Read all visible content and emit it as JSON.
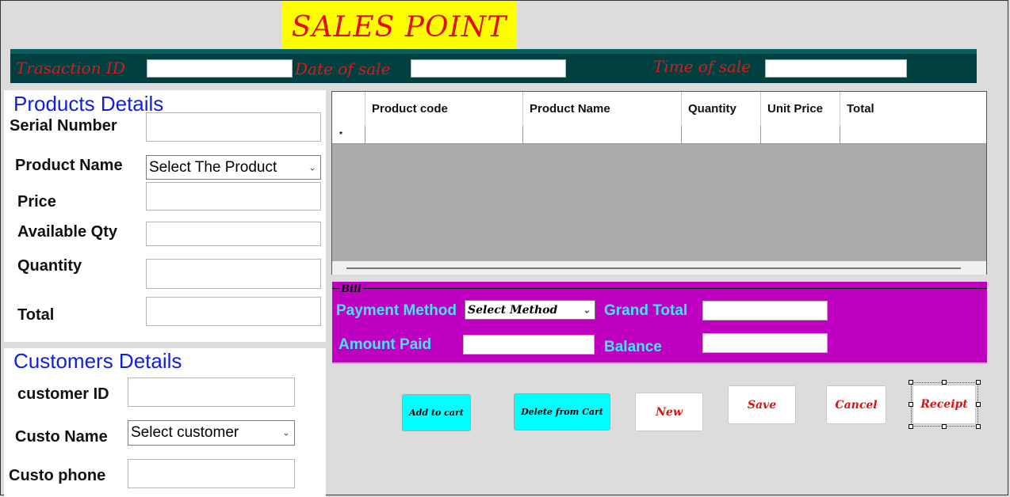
{
  "header": {
    "title": "SALES POINT"
  },
  "top_bar": {
    "transaction_label": "Trasaction ID",
    "date_label": "Date of sale",
    "time_label": "Time of sale"
  },
  "products": {
    "title": "Products Details",
    "serial_label": "Serial Number",
    "product_name_label": "Product Name",
    "product_select_value": "Select The Product",
    "price_label": "Price",
    "available_label": "Available Qty",
    "quantity_label": "Quantity",
    "total_label": "Total"
  },
  "customers": {
    "title": "Customers Details",
    "id_label": "customer ID",
    "name_label": "Custo Name",
    "name_select_value": "Select customer",
    "phone_label": "Custo phone"
  },
  "grid": {
    "columns": [
      "Product code",
      "Product Name",
      "Quantity",
      "Unit Price",
      "Total"
    ],
    "new_row_marker": "*"
  },
  "bill": {
    "legend": "Bill",
    "payment_label": "Payment Method",
    "payment_select_value": "Select Method",
    "grand_total_label": "Grand Total",
    "amount_paid_label": "Amount Paid",
    "balance_label": "Balance"
  },
  "buttons": {
    "add": "Add to cart",
    "delete": "Delete  from Cart",
    "new": "New",
    "save": "Save",
    "cancel": "Cancel",
    "receipt": "Receipt"
  },
  "colors": {
    "title_bg": "#ffff00",
    "title_text": "#e01010",
    "top_bar": "#014040",
    "bill_bg": "#bf00c0",
    "bill_text": "#3de8ff",
    "section_title": "#1020e0",
    "cyan_button": "#00ffff"
  }
}
